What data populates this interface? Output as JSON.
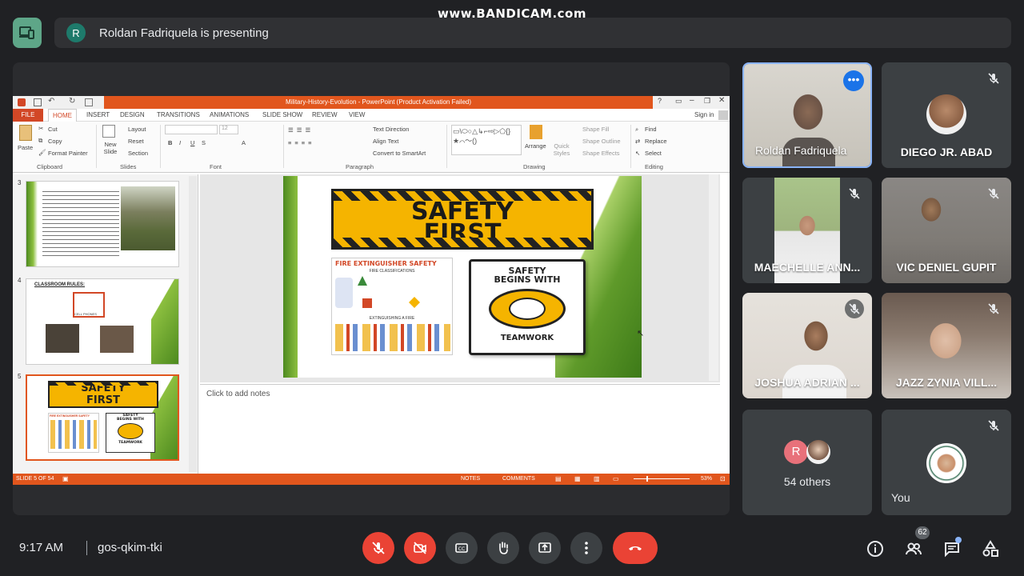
{
  "watermark": "www.BANDICAM.com",
  "presenting": {
    "avatar_letter": "R",
    "text": "Roldan Fadriquela is presenting"
  },
  "ppt": {
    "title": "Military-History-Evolution - PowerPoint (Product Activation Failed)",
    "sign_in": "Sign in",
    "tabs": [
      "FILE",
      "HOME",
      "INSERT",
      "DESIGN",
      "TRANSITIONS",
      "ANIMATIONS",
      "SLIDE SHOW",
      "REVIEW",
      "VIEW"
    ],
    "ribbon": {
      "paste": "Paste",
      "cut": "Cut",
      "copy": "Copy",
      "format_painter": "Format Painter",
      "clipboard": "Clipboard",
      "new_slide": "New Slide",
      "layout": "Layout",
      "reset": "Reset",
      "section": "Section",
      "slides": "Slides",
      "font_size": "12",
      "font": "Font",
      "text_direction": "Text Direction",
      "align_text": "Align Text",
      "convert_smartart": "Convert to SmartArt",
      "paragraph": "Paragraph",
      "arrange": "Arrange",
      "quick_styles": "Quick Styles",
      "shape_fill": "Shape Fill",
      "shape_outline": "Shape Outline",
      "shape_effects": "Shape Effects",
      "drawing": "Drawing",
      "find": "Find",
      "replace": "Replace",
      "select": "Select",
      "editing": "Editing"
    },
    "thumbs": [
      {
        "num": "3"
      },
      {
        "num": "4",
        "title": "CLASSROOM RULES:",
        "sub": "CELL PHONES"
      },
      {
        "num": "5",
        "title1": "SAFETY",
        "title2": "FIRST",
        "fe": "FIRE EXTINGUISHER SAFETY",
        "sb1": "SAFETY",
        "sb2": "BEGINS WITH",
        "sb3": "TEAMWORK"
      }
    ],
    "slide": {
      "banner1": "SAFETY",
      "banner2": "FIRST",
      "fe_title": "FIRE EXTINGUISHER SAFETY",
      "fe_classes": "FIRE CLASSIFICATIONS",
      "fe_ext": "EXTINGUISHING A FIRE",
      "sb1": "SAFETY",
      "sb2": "BEGINS WITH",
      "sb3": "TEAMWORK"
    },
    "notes": "Click to add notes",
    "status": {
      "slide": "SLIDE 5 OF 54",
      "notes": "NOTES",
      "comments": "COMMENTS",
      "zoom": "53%"
    }
  },
  "participants": [
    {
      "name": "Roldan Fadriquela"
    },
    {
      "name": "DIEGO JR. ABAD"
    },
    {
      "name": "MAECHELLE ANN..."
    },
    {
      "name": "VIC DENIEL GUPIT"
    },
    {
      "name": "JOSHUA ADRIAN ..."
    },
    {
      "name": "JAZZ ZYNIA VILL..."
    },
    {
      "name": "54 others",
      "avatar_letter": "R"
    },
    {
      "name": "You"
    }
  ],
  "bottom": {
    "time": "9:17 AM",
    "meeting_code": "gos-qkim-tki",
    "people_count": "62"
  },
  "colors": {
    "accent_red": "#ea4335",
    "panel": "#3c4043",
    "ppt_orange": "#e1561d",
    "selected_tile": "#8ab4f8"
  }
}
